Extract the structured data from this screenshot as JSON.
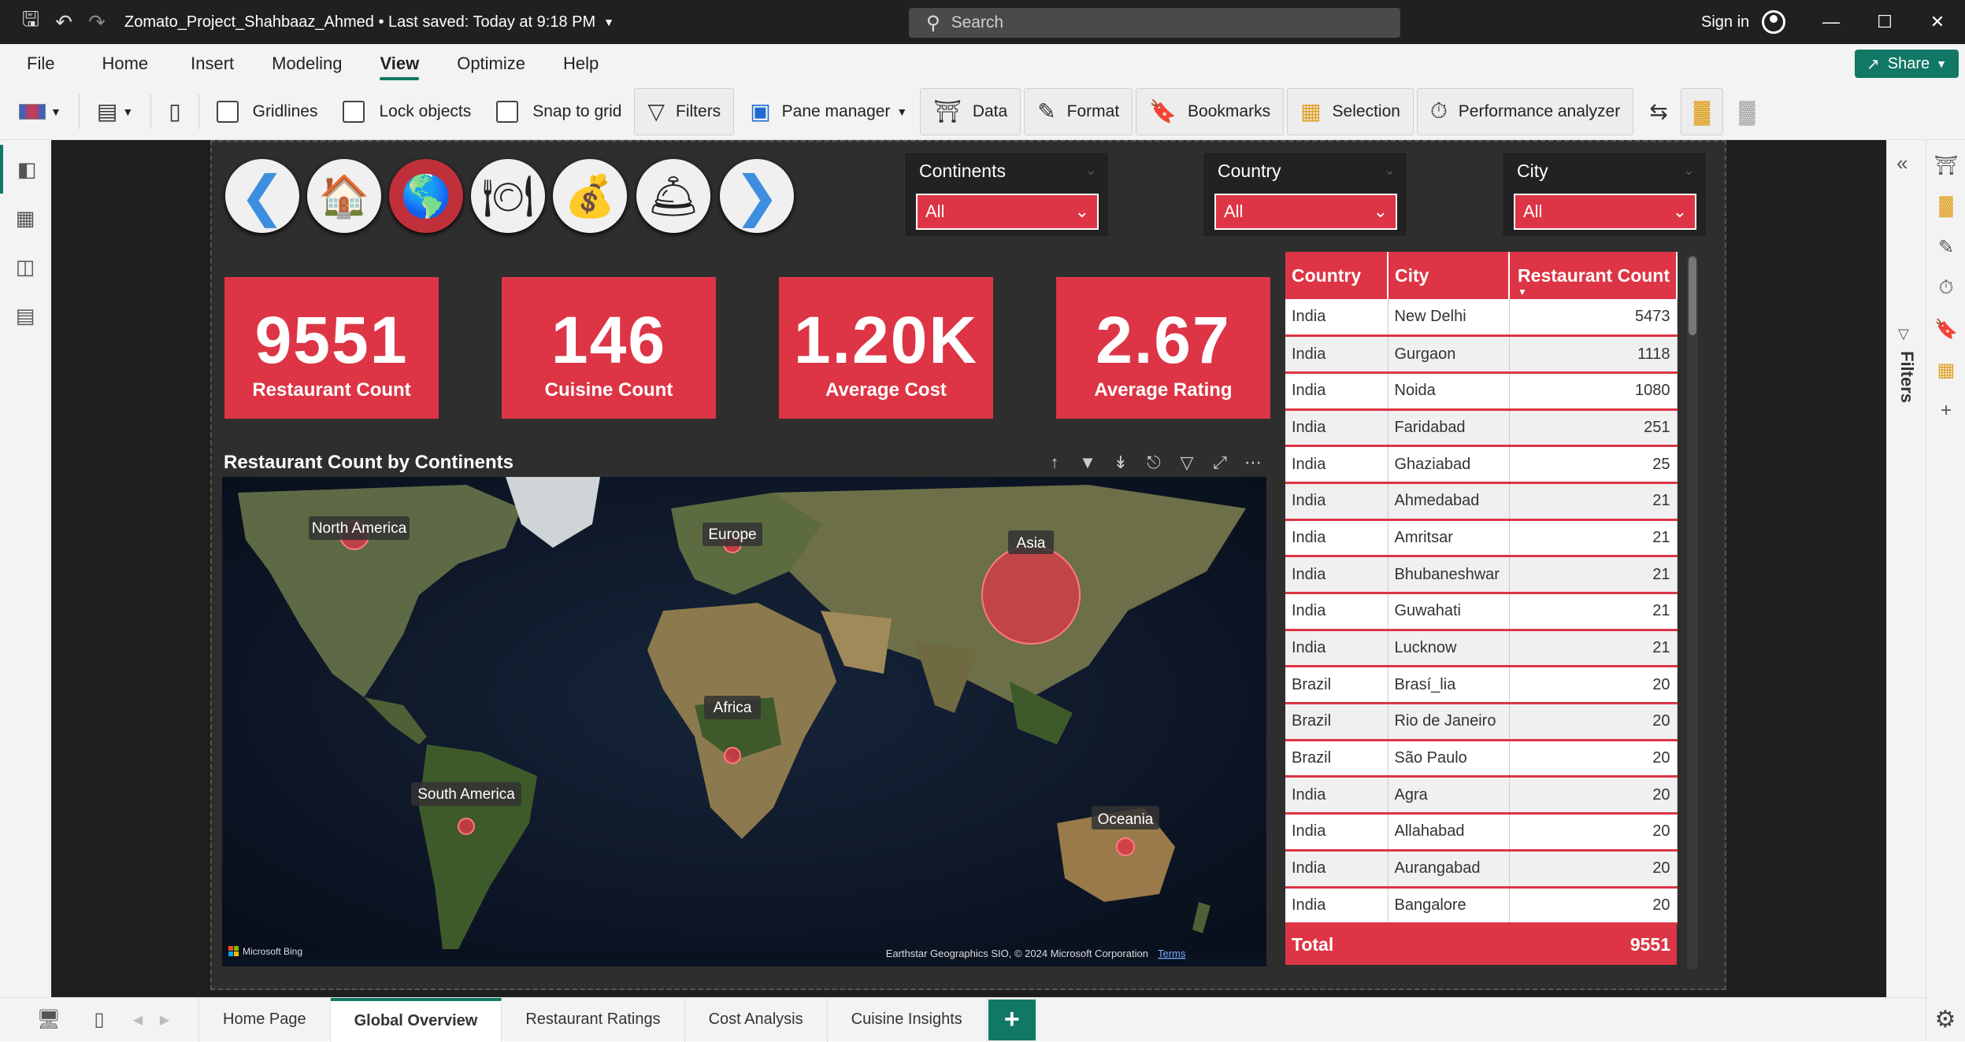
{
  "titlebar": {
    "title": "Zomato_Project_Shahbaaz_Ahmed",
    "saved": "• Last saved: Today at 9:18 PM",
    "search_placeholder": "Search",
    "signin": "Sign in"
  },
  "menu": [
    "File",
    "Home",
    "Insert",
    "Modeling",
    "View",
    "Optimize",
    "Help"
  ],
  "share_label": "Share",
  "toolbar": {
    "gridlines": "Gridlines",
    "lock_objects": "Lock objects",
    "snap_to_grid": "Snap to grid",
    "filters": "Filters",
    "pane_manager": "Pane manager",
    "data": "Data",
    "format": "Format",
    "bookmarks": "Bookmarks",
    "selection": "Selection",
    "performance": "Performance analyzer"
  },
  "slicers": [
    {
      "title": "Continents",
      "value": "All"
    },
    {
      "title": "Country",
      "value": "All"
    },
    {
      "title": "City",
      "value": "All"
    }
  ],
  "kpis": [
    {
      "value": "9551",
      "label": "Restaurant Count"
    },
    {
      "value": "146",
      "label": "Cuisine Count"
    },
    {
      "value": "1.20K",
      "label": "Average Cost"
    },
    {
      "value": "2.67",
      "label": "Average Rating"
    }
  ],
  "map": {
    "title": "Restaurant Count by Continents",
    "attribution": "Earthstar Geographics SIO, © 2024 Microsoft Corporation",
    "terms": "Terms",
    "bing": "Microsoft Bing",
    "bubbles": [
      {
        "name": "North America"
      },
      {
        "name": "Europe"
      },
      {
        "name": "Asia"
      },
      {
        "name": "Africa"
      },
      {
        "name": "South America"
      },
      {
        "name": "Oceania"
      }
    ]
  },
  "table": {
    "headers": [
      "Country",
      "City",
      "Restaurant Count"
    ],
    "rows": [
      [
        "India",
        "New Delhi",
        "5473"
      ],
      [
        "India",
        "Gurgaon",
        "1118"
      ],
      [
        "India",
        "Noida",
        "1080"
      ],
      [
        "India",
        "Faridabad",
        "251"
      ],
      [
        "India",
        "Ghaziabad",
        "25"
      ],
      [
        "India",
        "Ahmedabad",
        "21"
      ],
      [
        "India",
        "Amritsar",
        "21"
      ],
      [
        "India",
        "Bhubaneshwar",
        "21"
      ],
      [
        "India",
        "Guwahati",
        "21"
      ],
      [
        "India",
        "Lucknow",
        "21"
      ],
      [
        "Brazil",
        "Brasí_lia",
        "20"
      ],
      [
        "Brazil",
        "Rio de Janeiro",
        "20"
      ],
      [
        "Brazil",
        "São Paulo",
        "20"
      ],
      [
        "India",
        "Agra",
        "20"
      ],
      [
        "India",
        "Allahabad",
        "20"
      ],
      [
        "India",
        "Aurangabad",
        "20"
      ],
      [
        "India",
        "Bangalore",
        "20"
      ]
    ],
    "total_label": "Total",
    "total_value": "9551"
  },
  "filters_label": "Filters",
  "pages": [
    "Home Page",
    "Global Overview",
    "Restaurant Ratings",
    "Cost Analysis",
    "Cuisine Insights"
  ],
  "colors": {
    "accent": "#dd3545",
    "brand": "#117865"
  }
}
